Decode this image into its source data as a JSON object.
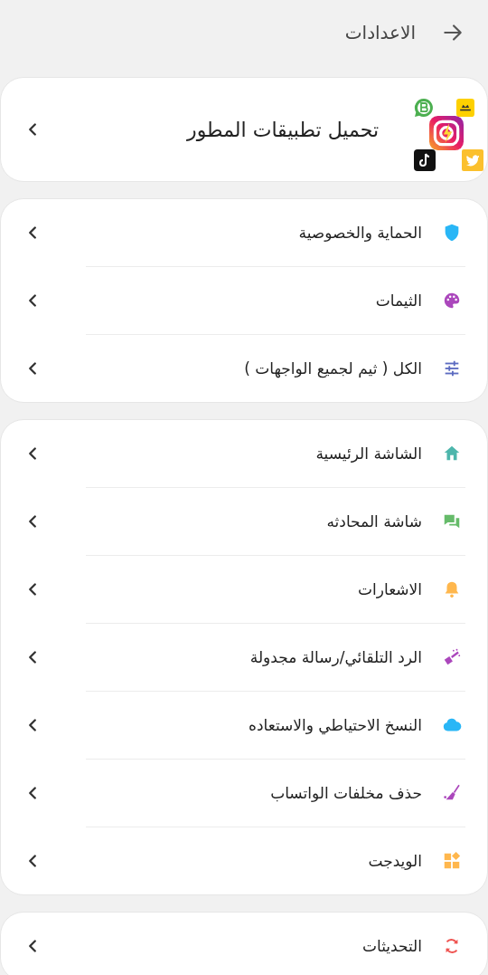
{
  "header": {
    "title": "الاعدادات"
  },
  "featured": {
    "label": "تحميل تطبيقات المطور"
  },
  "groups": [
    {
      "items": [
        {
          "label": "الحماية والخصوصية"
        },
        {
          "label": "الثيمات"
        },
        {
          "label": "الكل ( ثيم لجميع الواجهات )"
        }
      ]
    },
    {
      "items": [
        {
          "label": "الشاشة الرئيسية"
        },
        {
          "label": "شاشة المحادثه"
        },
        {
          "label": "الاشعارات"
        },
        {
          "label": "الرد التلقائي/رسالة مجدولة"
        },
        {
          "label": "النسخ الاحتياطي والاستعاده"
        },
        {
          "label": "حذف مخلفات الواتساب"
        },
        {
          "label": "الويدجت"
        }
      ]
    },
    {
      "items": [
        {
          "label": "التحديثات"
        }
      ]
    }
  ]
}
